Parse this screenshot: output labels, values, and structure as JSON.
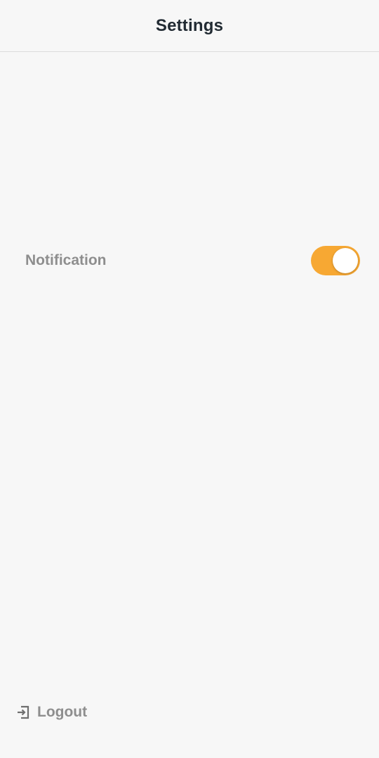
{
  "header": {
    "title": "Settings"
  },
  "settings": {
    "notification": {
      "label": "Notification",
      "enabled": true
    }
  },
  "footer": {
    "logout_label": "Logout",
    "logout_icon": "logout-icon"
  },
  "colors": {
    "accent": "#f7a833",
    "label_gray": "#8e8e8e",
    "title_dark": "#222b33",
    "background": "#f7f7f7"
  }
}
